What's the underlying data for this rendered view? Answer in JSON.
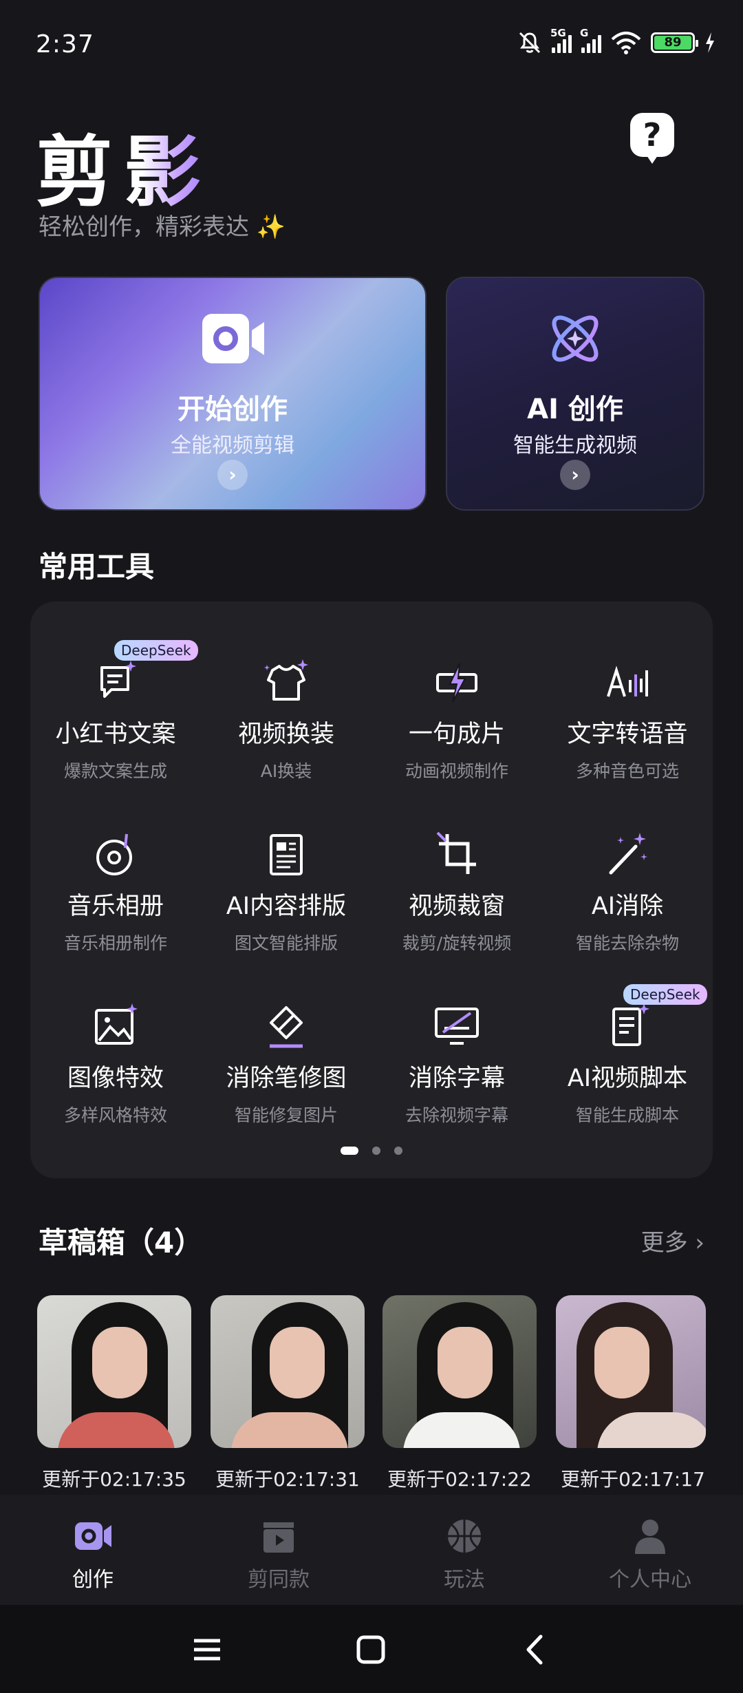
{
  "status_bar": {
    "time": "2:37",
    "signal1_label": "5G",
    "signal2_label": "G",
    "battery": "89"
  },
  "header": {
    "app_name_first": "剪",
    "app_name_second": "影",
    "tagline": "轻松创作，精彩表达 ✨",
    "help_label": "?"
  },
  "hero": {
    "start": {
      "title": "开始创作",
      "subtitle": "全能视频剪辑",
      "arrow": "›"
    },
    "ai": {
      "title": "AI 创作",
      "subtitle": "智能生成视频",
      "arrow": "›"
    }
  },
  "tools": {
    "section_title": "常用工具",
    "items": [
      {
        "name": "小红书文案",
        "desc": "爆款文案生成",
        "badge": "DeepSeek"
      },
      {
        "name": "视频换装",
        "desc": "AI换装"
      },
      {
        "name": "一句成片",
        "desc": "动画视频制作"
      },
      {
        "name": "文字转语音",
        "desc": "多种音色可选"
      },
      {
        "name": "音乐相册",
        "desc": "音乐相册制作"
      },
      {
        "name": "AI内容排版",
        "desc": "图文智能排版"
      },
      {
        "name": "视频裁窗",
        "desc": "裁剪/旋转视频"
      },
      {
        "name": "AI消除",
        "desc": "智能去除杂物"
      },
      {
        "name": "图像特效",
        "desc": "多样风格特效"
      },
      {
        "name": "消除笔修图",
        "desc": "智能修复图片"
      },
      {
        "name": "消除字幕",
        "desc": "去除视频字幕"
      },
      {
        "name": "AI视频脚本",
        "desc": "智能生成脚本",
        "badge": "DeepSeek"
      }
    ],
    "page_count": 3,
    "current_page": 1
  },
  "drafts": {
    "section_title": "草稿箱（4）",
    "more_label": "更多 ›",
    "items": [
      {
        "time": "更新于02:17:35"
      },
      {
        "time": "更新于02:17:31"
      },
      {
        "time": "更新于02:17:22"
      },
      {
        "time": "更新于02:17:17"
      }
    ]
  },
  "bottom_nav": {
    "items": [
      {
        "label": "创作",
        "icon": "video-camera-icon",
        "active": true
      },
      {
        "label": "剪同款",
        "icon": "clapperboard-icon",
        "active": false
      },
      {
        "label": "玩法",
        "icon": "basketball-icon",
        "active": false
      },
      {
        "label": "个人中心",
        "icon": "person-icon",
        "active": false
      }
    ]
  },
  "colors": {
    "background": "#17171b",
    "panel": "#222226",
    "accent": "#a07cff",
    "muted": "#9a9aa3"
  }
}
